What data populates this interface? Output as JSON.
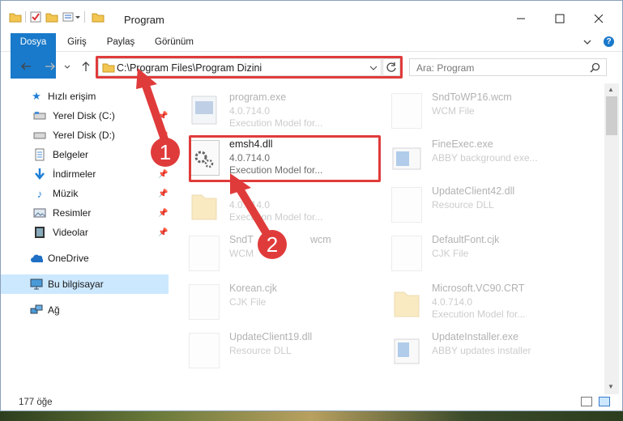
{
  "window": {
    "title": "Program"
  },
  "ribbon": {
    "tabs": [
      "Dosya",
      "Giriş",
      "Paylaş",
      "Görünüm"
    ]
  },
  "address": {
    "path": "C:\\Program Files\\Program Dizini"
  },
  "search": {
    "placeholder": "Ara: Program"
  },
  "sidebar": {
    "items": [
      {
        "label": "Hızlı erişim",
        "icon": "star-icon",
        "pinned": false
      },
      {
        "label": "Yerel Disk (C:)",
        "icon": "drive-icon",
        "pinned": true
      },
      {
        "label": "Yerel Disk (D:)",
        "icon": "drive-icon",
        "pinned": true
      },
      {
        "label": "Belgeler",
        "icon": "documents-icon",
        "pinned": true
      },
      {
        "label": "İndirmeler",
        "icon": "download-icon",
        "pinned": true
      },
      {
        "label": "Müzik",
        "icon": "music-icon",
        "pinned": true
      },
      {
        "label": "Resimler",
        "icon": "pictures-icon",
        "pinned": true
      },
      {
        "label": "Videolar",
        "icon": "video-icon",
        "pinned": true
      },
      {
        "label": "OneDrive",
        "icon": "cloud-icon",
        "pinned": false
      },
      {
        "label": "Bu bilgisayar",
        "icon": "computer-icon",
        "pinned": false
      },
      {
        "label": "Ağ",
        "icon": "network-icon",
        "pinned": false
      }
    ]
  },
  "files": {
    "left": [
      {
        "name": "program.exe",
        "line1": "4.0.714.0",
        "line2": "Execution Model for..."
      },
      {
        "name": "emsh4.dll",
        "line1": "4.0.714.0",
        "line2": "Execution Model for..."
      },
      {
        "name": "",
        "line1": "4.0.714.0",
        "line2": "Execution Model for..."
      },
      {
        "name": "SndT",
        "name_tail": "wcm",
        "line1": "WCM",
        "line2": ""
      },
      {
        "name": "Korean.cjk",
        "line1": "CJK File",
        "line2": ""
      },
      {
        "name": "UpdateClient19.dll",
        "line1": "Resource DLL",
        "line2": ""
      }
    ],
    "right": [
      {
        "name": "SndToWP16.wcm",
        "line1": "WCM File",
        "line2": ""
      },
      {
        "name": "FineExec.exe",
        "line1": "ABBY background exe...",
        "line2": ""
      },
      {
        "name": "UpdateClient42.dll",
        "line1": "Resource DLL",
        "line2": ""
      },
      {
        "name": "DefaultFont.cjk",
        "line1": "CJK File",
        "line2": ""
      },
      {
        "name": "Microsoft.VC90.CRT",
        "line1": "4.0.714.0",
        "line2": "Execution Model for..."
      },
      {
        "name": "UpdateInstaller.exe",
        "line1": "ABBY updates installer",
        "line2": ""
      }
    ]
  },
  "annotations": {
    "step1": "1",
    "step2": "2"
  },
  "status": {
    "count": "177 öğe"
  },
  "colors": {
    "accent": "#1979ca",
    "highlight": "#e03b3b",
    "selected": "#cce8ff"
  }
}
